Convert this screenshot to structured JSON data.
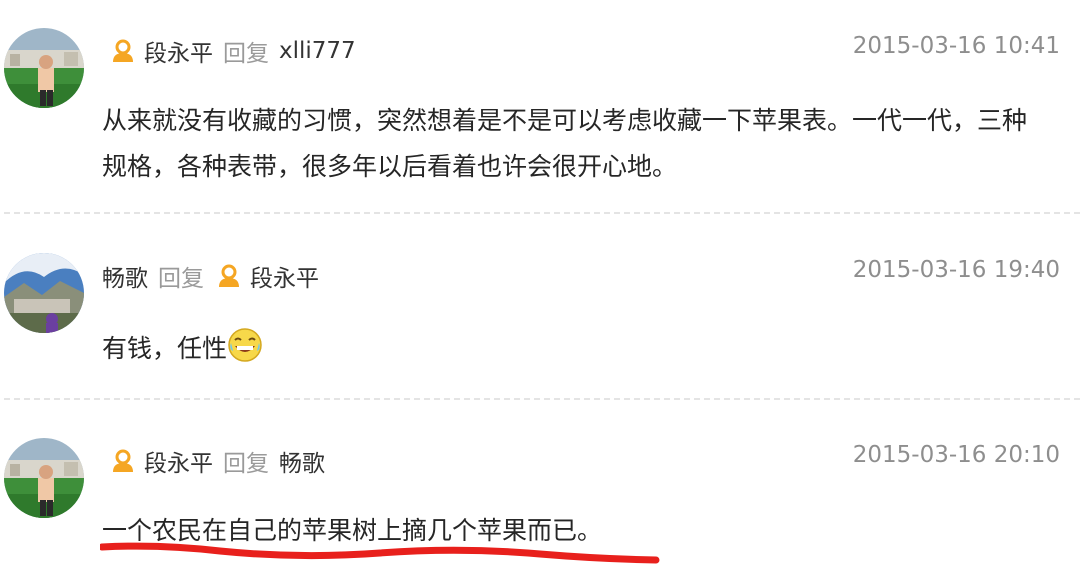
{
  "comments": [
    {
      "author": "段永平",
      "reply_word": "回复",
      "reply_to": "xlli777",
      "timestamp": "2015-03-16 10:41",
      "text": "从来就没有收藏的习惯，突然想着是不是可以考虑收藏一下苹果表。一代一代，三种规格，各种表带，很多年以后看着也许会很开心地。"
    },
    {
      "author": "畅歌",
      "reply_word": "回复",
      "reply_to": "段永平",
      "timestamp": "2015-03-16 19:40",
      "text": "有钱，任性"
    },
    {
      "author": "段永平",
      "reply_word": "回复",
      "reply_to": "畅歌",
      "timestamp": "2015-03-16 20:10",
      "text": "一个农民在自己的苹果树上摘几个苹果而已。"
    }
  ],
  "icons": {
    "vip_badge": "user-badge-icon",
    "emoji": "laughing-tears-emoji-icon"
  },
  "colors": {
    "vip_badge": "#f5a623",
    "annotation_underline": "#e8201c",
    "timestamp": "#8e8e8e",
    "reply_word": "#9a9a9a"
  }
}
